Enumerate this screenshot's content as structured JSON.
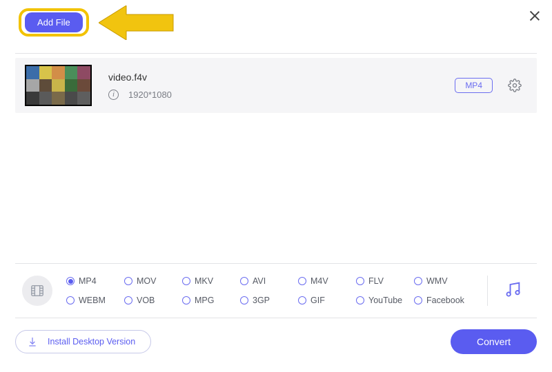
{
  "toolbar": {
    "add_file_label": "Add File"
  },
  "file": {
    "name": "video.f4v",
    "resolution": "1920*1080",
    "output_badge": "MP4"
  },
  "formats": {
    "selected": "MP4",
    "options": [
      "MP4",
      "MOV",
      "MKV",
      "AVI",
      "M4V",
      "FLV",
      "WMV",
      "WEBM",
      "VOB",
      "MPG",
      "3GP",
      "GIF",
      "YouTube",
      "Facebook"
    ]
  },
  "footer": {
    "install_label": "Install Desktop Version",
    "convert_label": "Convert"
  },
  "colors": {
    "accent": "#5a5cf0",
    "highlight": "#f2c200"
  }
}
